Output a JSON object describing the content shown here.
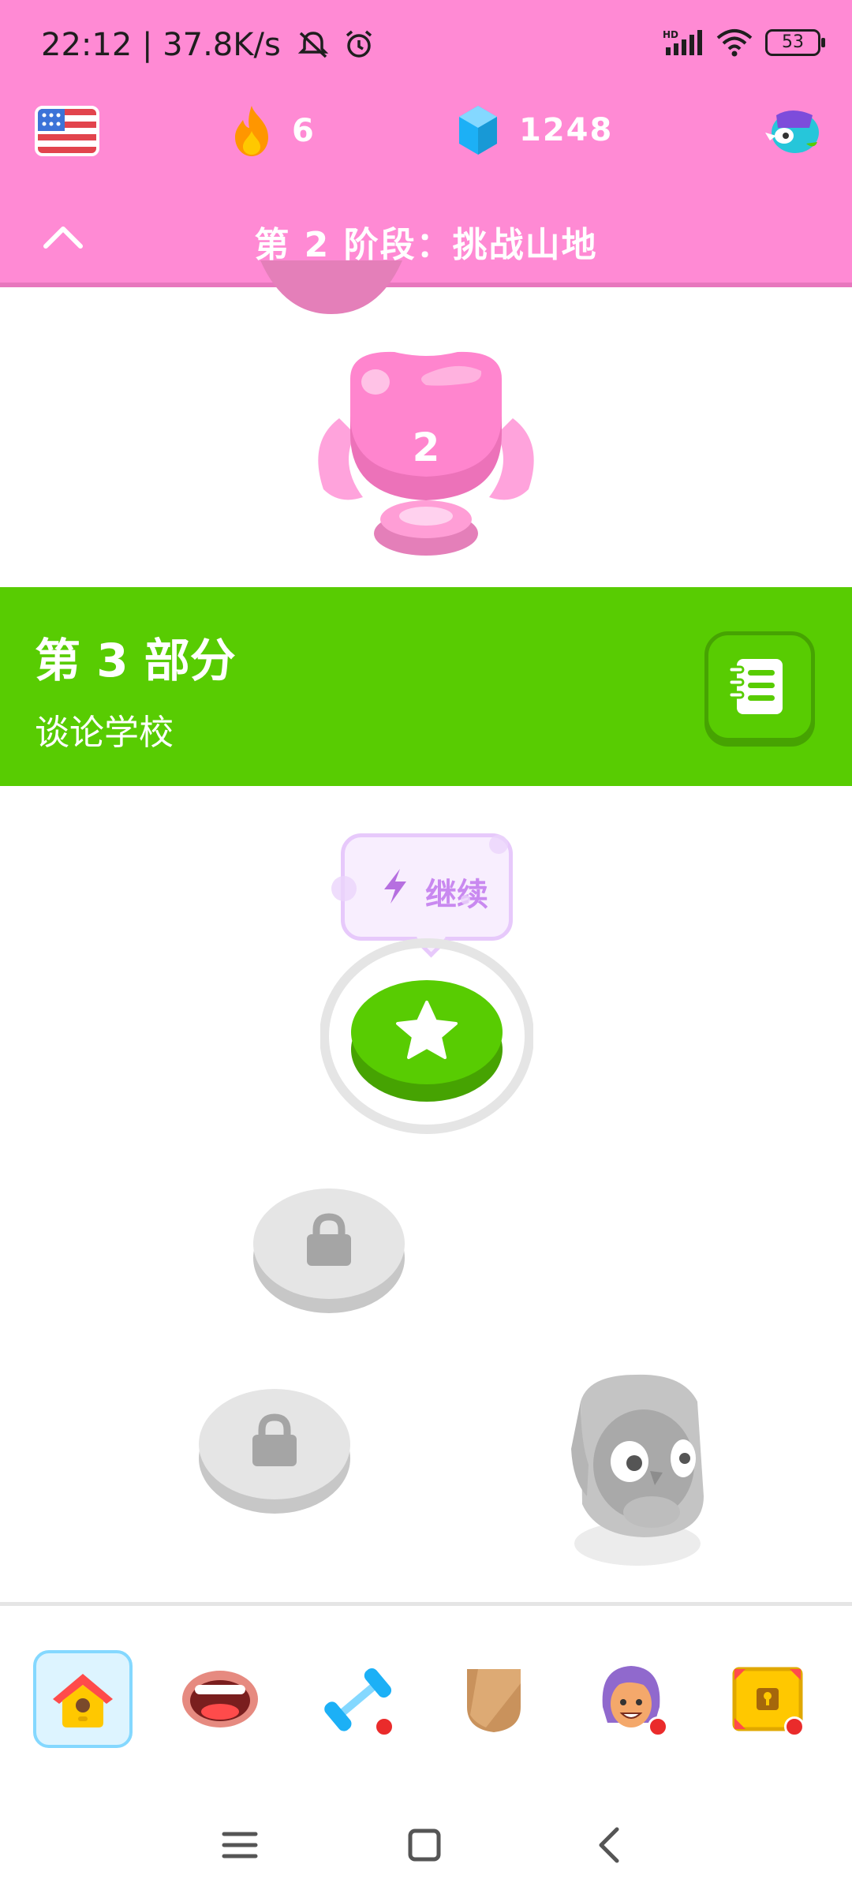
{
  "status_bar": {
    "time_speed": "22:12 | 37.8K/s",
    "battery": "53"
  },
  "header": {
    "language_flag": "us-flag-icon",
    "streak_count": "6",
    "gem_count": "1248",
    "section_title": "第 2 阶段：挑战山地"
  },
  "path": {
    "trophy_level": "2",
    "unit_title": "第 3 部分",
    "unit_subtitle": "谈论学校",
    "tooltip_label": "继续"
  },
  "colors": {
    "header_bg": "#ff8ad4",
    "unit_bg": "#58cc02",
    "tooltip_text": "#c989f0"
  },
  "bottom_nav": {
    "items": [
      "home-icon",
      "speaking-lips-icon",
      "practice-dumbbell-icon",
      "league-shield-icon",
      "profile-avatar-icon",
      "treasure-chest-icon"
    ]
  }
}
